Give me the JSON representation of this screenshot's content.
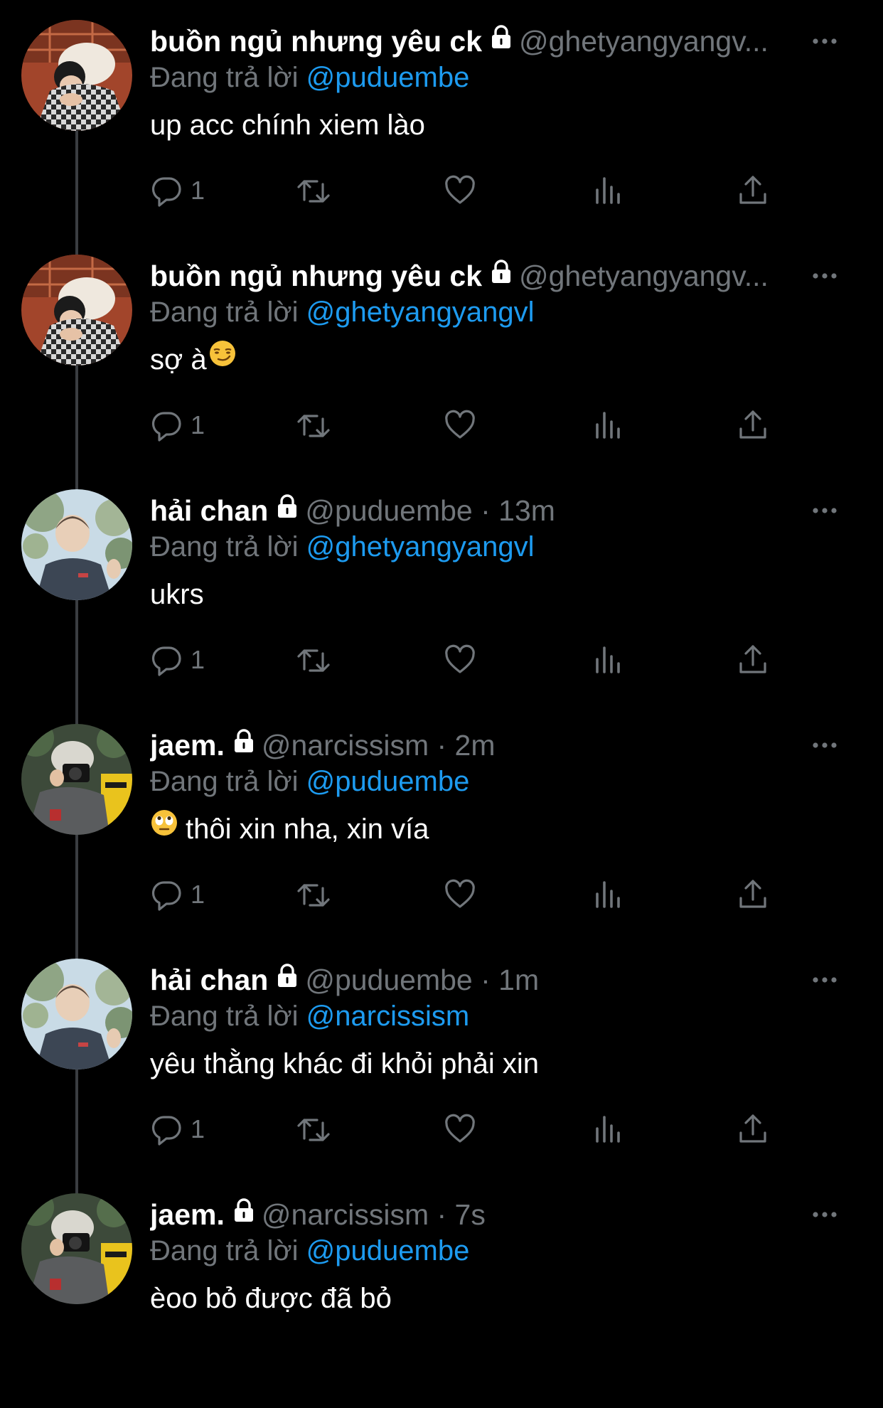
{
  "colors": {
    "background": "#000000",
    "text_primary": "#ffffff",
    "text_secondary": "#71767b",
    "link": "#1d9bf0",
    "thread_line": "#3a3d41"
  },
  "tweets": [
    {
      "display_name": "buồn ngủ nhưng yêu ck",
      "handle": "@ghetyangyangv...",
      "time": "",
      "reply_prefix": "Đang trả lời",
      "reply_to": "@puduembe",
      "text": "up acc chính xiem lào",
      "emoji_before": "",
      "emoji_after": "",
      "reply_count": "1",
      "avatar": "avatar-checkered-hood"
    },
    {
      "display_name": "buồn ngủ nhưng yêu ck",
      "handle": "@ghetyangyangv...",
      "time": "",
      "reply_prefix": "Đang trả lời",
      "reply_to": "@ghetyangyangvl",
      "text": "sợ à",
      "emoji_before": "",
      "emoji_after": "smirk-emoji",
      "reply_count": "1",
      "avatar": "avatar-checkered-hood"
    },
    {
      "display_name": "hải chan",
      "handle": "@puduembe",
      "time": "13m",
      "reply_prefix": "Đang trả lời",
      "reply_to": "@ghetyangyangvl",
      "text": "ukrs",
      "emoji_before": "",
      "emoji_after": "",
      "reply_count": "1",
      "avatar": "avatar-outdoor-tree"
    },
    {
      "display_name": "jaem.",
      "handle": "@narcissism",
      "time": "2m",
      "reply_prefix": "Đang trả lời",
      "reply_to": "@puduembe",
      "text": "thôi xin nha, xin vía",
      "emoji_before": "eye-roll-emoji",
      "emoji_after": "",
      "reply_count": "1",
      "avatar": "avatar-camera"
    },
    {
      "display_name": "hải chan",
      "handle": "@puduembe",
      "time": "1m",
      "reply_prefix": "Đang trả lời",
      "reply_to": "@narcissism",
      "text": "yêu thằng khác đi khỏi phải xin",
      "emoji_before": "",
      "emoji_after": "",
      "reply_count": "1",
      "avatar": "avatar-outdoor-tree"
    },
    {
      "display_name": "jaem.",
      "handle": "@narcissism",
      "time": "7s",
      "reply_prefix": "Đang trả lời",
      "reply_to": "@puduembe",
      "text": "èoo bỏ được đã bỏ",
      "emoji_before": "",
      "emoji_after": "",
      "reply_count": "",
      "avatar": "avatar-camera"
    }
  ],
  "icons": {
    "lock": "lock-icon",
    "more": "more-options-icon",
    "reply": "reply-icon",
    "retweet": "retweet-icon",
    "like": "like-icon",
    "views": "views-icon",
    "share": "share-icon"
  }
}
